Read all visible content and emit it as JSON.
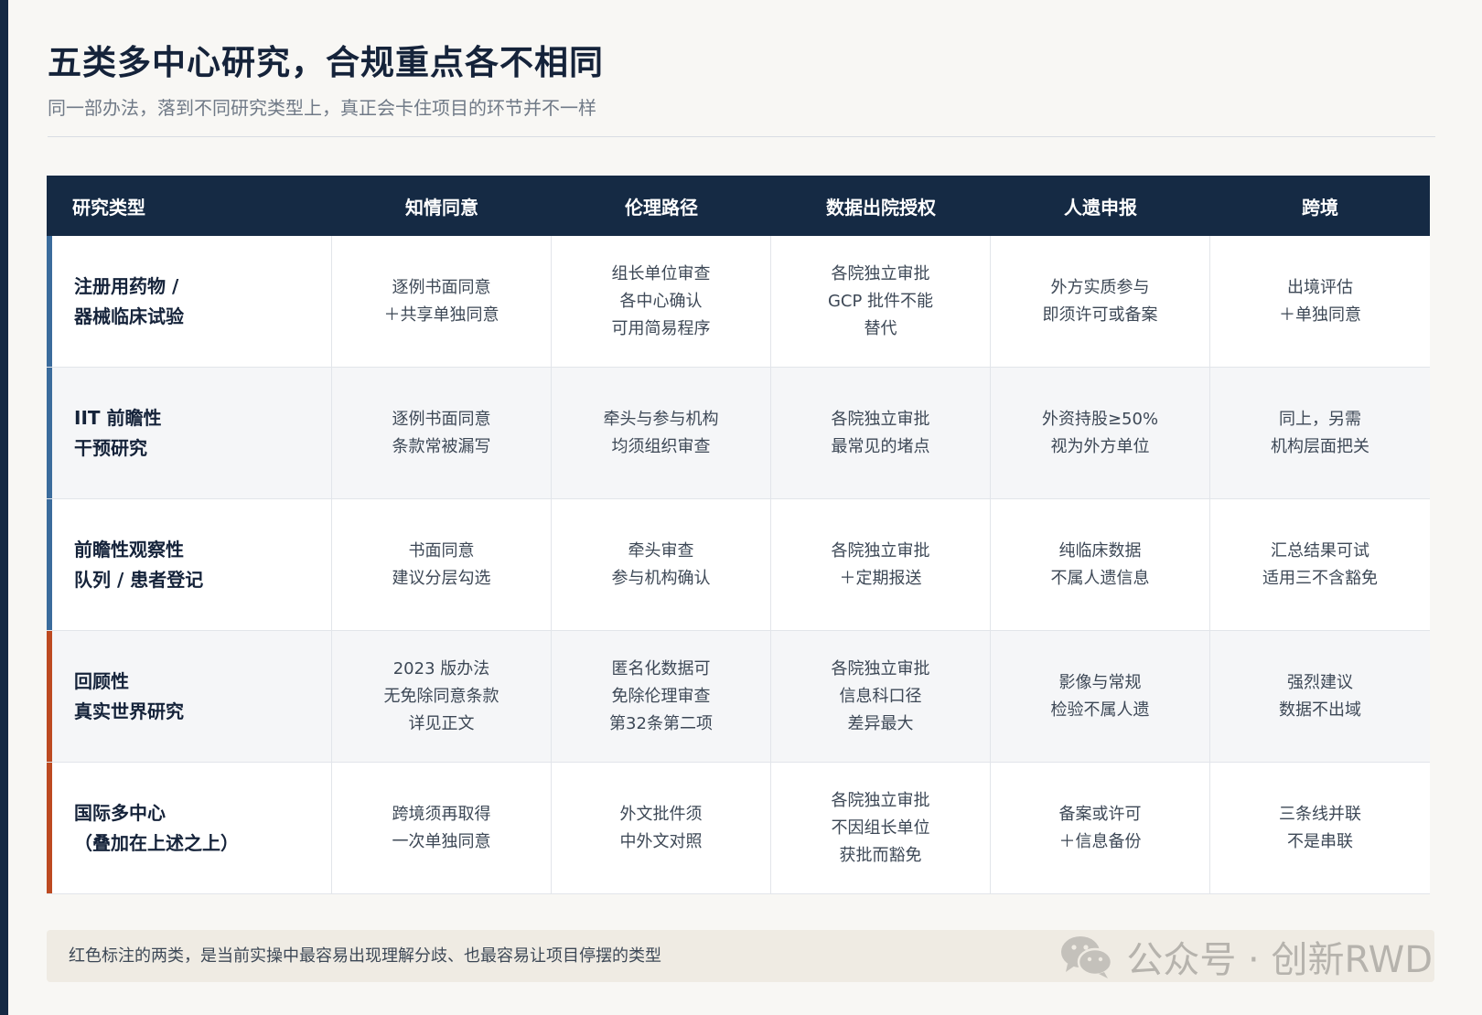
{
  "title": "五类多中心研究，合规重点各不相同",
  "subtitle": "同一部办法，落到不同研究类型上，真正会卡住项目的环节并不一样",
  "colors": {
    "header_bg": "#152a44",
    "accent_blue": "#3b6c9c",
    "accent_red": "#bd4a21"
  },
  "table": {
    "headers": [
      "研究类型",
      "知情同意",
      "伦理路径",
      "数据出院授权",
      "人遗申报",
      "跨境"
    ],
    "rows": [
      {
        "marker": "blue",
        "type_lines": [
          "注册用药物 /",
          "器械临床试验"
        ],
        "cells": [
          [
            "逐例书面同意",
            "＋共享单独同意"
          ],
          [
            "组长单位审查",
            "各中心确认",
            "可用简易程序"
          ],
          [
            "各院独立审批",
            "GCP 批件不能",
            "替代"
          ],
          [
            "外方实质参与",
            "即须许可或备案"
          ],
          [
            "出境评估",
            "＋单独同意"
          ]
        ]
      },
      {
        "marker": "blue",
        "type_lines": [
          "IIT 前瞻性",
          "干预研究"
        ],
        "cells": [
          [
            "逐例书面同意",
            "条款常被漏写"
          ],
          [
            "牵头与参与机构",
            "均须组织审查"
          ],
          [
            "各院独立审批",
            "最常见的堵点"
          ],
          [
            "外资持股≥50%",
            "视为外方单位"
          ],
          [
            "同上，另需",
            "机构层面把关"
          ]
        ]
      },
      {
        "marker": "blue",
        "type_lines": [
          "前瞻性观察性",
          "队列 / 患者登记"
        ],
        "cells": [
          [
            "书面同意",
            "建议分层勾选"
          ],
          [
            "牵头审查",
            "参与机构确认"
          ],
          [
            "各院独立审批",
            "＋定期报送"
          ],
          [
            "纯临床数据",
            "不属人遗信息"
          ],
          [
            "汇总结果可试",
            "适用三不含豁免"
          ]
        ]
      },
      {
        "marker": "red",
        "type_lines": [
          "回顾性",
          "真实世界研究"
        ],
        "cells": [
          [
            "2023 版办法",
            "无免除同意条款",
            "详见正文"
          ],
          [
            "匿名化数据可",
            "免除伦理审查",
            "第32条第二项"
          ],
          [
            "各院独立审批",
            "信息科口径",
            "差异最大"
          ],
          [
            "影像与常规",
            "检验不属人遗"
          ],
          [
            "强烈建议",
            "数据不出域"
          ]
        ]
      },
      {
        "marker": "red",
        "type_lines": [
          "国际多中心",
          "（叠加在上述之上）"
        ],
        "cells": [
          [
            "跨境须再取得",
            "一次单独同意"
          ],
          [
            "外文批件须",
            "中外文对照"
          ],
          [
            "各院独立审批",
            "不因组长单位",
            "获批而豁免"
          ],
          [
            "备案或许可",
            "＋信息备份"
          ],
          [
            "三条线并联",
            "不是串联"
          ]
        ]
      }
    ]
  },
  "footer_note": "红色标注的两类，是当前实操中最容易出现理解分歧、也最容易让项目停摆的类型",
  "watermark": {
    "icon": "wechat-icon",
    "text": "公众号 · 创新RWD"
  }
}
